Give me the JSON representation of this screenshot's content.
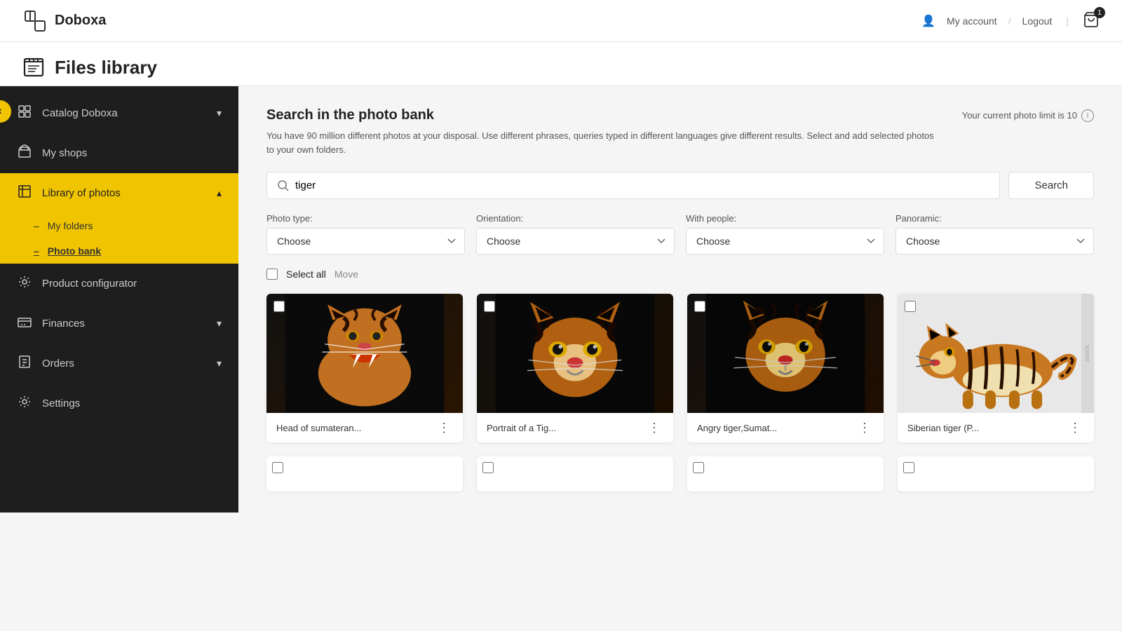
{
  "app": {
    "logo_text": "Doboxa",
    "page_title": "Files library"
  },
  "topnav": {
    "my_account": "My account",
    "separator": "/",
    "logout": "Logout",
    "cart_count": "1"
  },
  "sidebar": {
    "back_arrow": "‹",
    "items": [
      {
        "id": "catalog",
        "label": "Catalog Doboxa",
        "icon": "🖼",
        "has_chevron": true,
        "active": false
      },
      {
        "id": "my-shops",
        "label": "My shops",
        "icon": "🏪",
        "has_chevron": false,
        "active": false
      },
      {
        "id": "library",
        "label": "Library of photos",
        "icon": "📖",
        "has_chevron": true,
        "active": true,
        "sub_items": [
          {
            "id": "my-folders",
            "label": "My folders",
            "selected": false
          },
          {
            "id": "photo-bank",
            "label": "Photo bank",
            "selected": true
          }
        ]
      },
      {
        "id": "product-configurator",
        "label": "Product configurator",
        "icon": "🔧",
        "has_chevron": false,
        "active": false
      },
      {
        "id": "finances",
        "label": "Finances",
        "icon": "💳",
        "has_chevron": true,
        "active": false
      },
      {
        "id": "orders",
        "label": "Orders",
        "icon": "📋",
        "has_chevron": true,
        "active": false
      },
      {
        "id": "settings",
        "label": "Settings",
        "icon": "⚙",
        "has_chevron": false,
        "active": false
      }
    ]
  },
  "photo_bank": {
    "title": "Search in the photo bank",
    "photo_limit_label": "Your current photo limit is 10",
    "description": "You have 90 million different photos at your disposal. Use different phrases, queries typed in different languages give different results. Select and add selected photos to your own folders.",
    "search_placeholder": "tiger",
    "search_button": "Search",
    "filters": {
      "photo_type": {
        "label": "Photo type:",
        "placeholder": "Choose"
      },
      "orientation": {
        "label": "Orientation:",
        "placeholder": "Choose"
      },
      "with_people": {
        "label": "With people:",
        "placeholder": "Choose"
      },
      "panoramic": {
        "label": "Panoramic:",
        "placeholder": "Choose"
      }
    },
    "select_all_label": "Select all",
    "move_label": "Move",
    "photos": [
      {
        "id": 1,
        "name": "Head of sumateran...",
        "style": "tiger-1",
        "emoji": "🐯"
      },
      {
        "id": 2,
        "name": "Portrait of a Tig...",
        "style": "tiger-2",
        "emoji": "🐯"
      },
      {
        "id": 3,
        "name": "Angry tiger,Sumat...",
        "style": "tiger-3",
        "emoji": "🐯"
      },
      {
        "id": 4,
        "name": "Siberian tiger (P...",
        "style": "tiger-4",
        "emoji": "🐯"
      }
    ]
  }
}
